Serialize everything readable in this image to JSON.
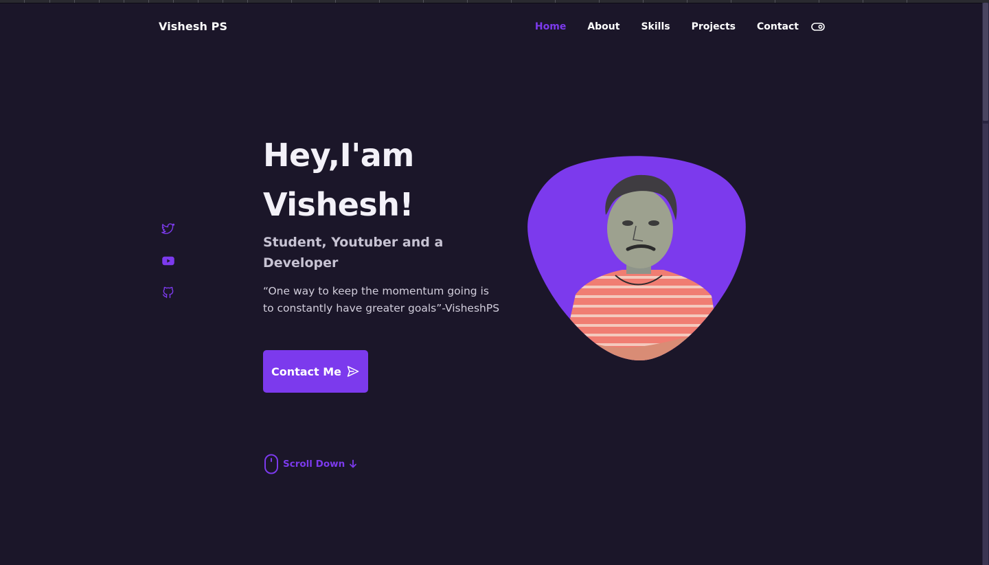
{
  "header": {
    "logo": "Vishesh PS",
    "nav": [
      {
        "label": "Home",
        "active": true
      },
      {
        "label": "About",
        "active": false
      },
      {
        "label": "Skills",
        "active": false
      },
      {
        "label": "Projects",
        "active": false
      },
      {
        "label": "Contact",
        "active": false
      }
    ],
    "theme_toggle_icon": "toggle-icon"
  },
  "socials": [
    {
      "icon": "twitter-icon"
    },
    {
      "icon": "youtube-icon"
    },
    {
      "icon": "github-icon"
    }
  ],
  "hero": {
    "title_line1": "Hey,I'am",
    "title_line2": "Vishesh!",
    "subtitle": "Student, Youtuber and a Developer",
    "quote": "“One way to keep the momentum going is to constantly have greater goals”-VisheshPS",
    "cta_label": "Contact Me",
    "cta_icon": "send-icon"
  },
  "scroll_down": {
    "label": "Scroll Down",
    "icon": "mouse-icon",
    "arrow_icon": "arrow-down-icon"
  },
  "colors": {
    "background": "#1b1629",
    "accent": "#7c3aed",
    "text": "#ffffff",
    "muted_text": "#c7c3d3"
  }
}
